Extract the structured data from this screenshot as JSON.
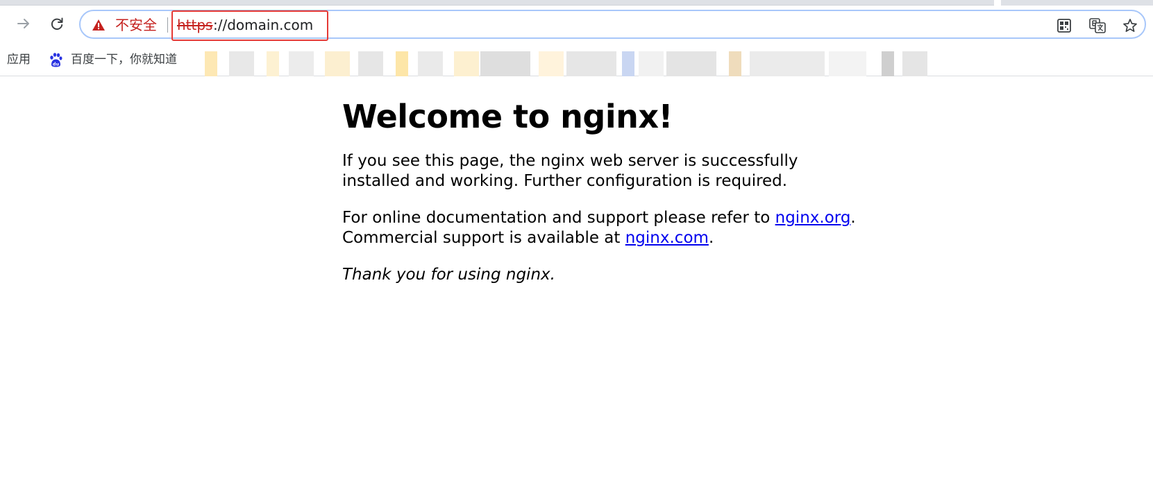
{
  "browser": {
    "security_label": "不安全",
    "url_scheme": "https",
    "url_rest": "://domain.com",
    "icons": [
      "forward-arrow",
      "reload",
      "warning-triangle",
      "qr-code",
      "translate",
      "star"
    ]
  },
  "bookmarks": {
    "apps_label": "应用",
    "items": [
      {
        "label": "百度一下，你就知道",
        "icon": "baidu-paw"
      }
    ]
  },
  "page": {
    "heading": "Welcome to nginx!",
    "para1": "If you see this page, the nginx web server is successfully installed and working. Further configuration is required.",
    "para2_prefix": "For online documentation and support please refer to ",
    "link_org": "nginx.org",
    "para2_mid": ".",
    "para2_line2": "Commercial support is available at ",
    "link_com": "nginx.com",
    "para2_end": ".",
    "thanks": "Thank you for using nginx."
  },
  "colors": {
    "insecure_red": "#c5221f",
    "link_blue": "#0000ee",
    "omnibox_border": "#a8c7fa"
  }
}
